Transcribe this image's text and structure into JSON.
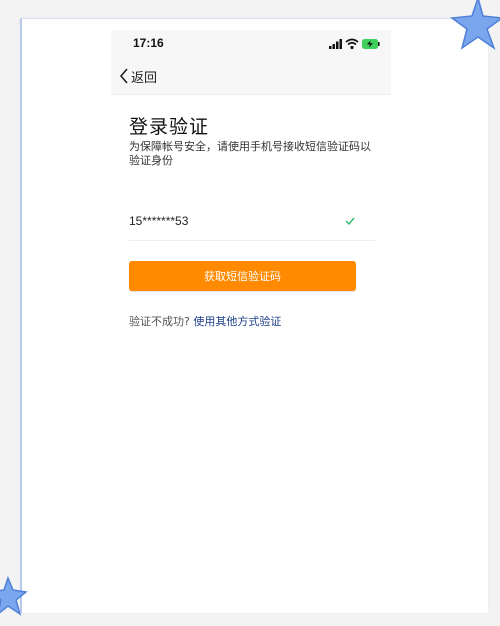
{
  "status_bar": {
    "time": "17:16"
  },
  "nav": {
    "back_label": "返回"
  },
  "verify": {
    "title": "登录验证",
    "description": "为保障帐号安全，请使用手机号接收短信验证码以验证身份",
    "phone": "15*******53"
  },
  "actions": {
    "get_code_button": "获取短信验证码",
    "fail_prompt": "验证不成功?",
    "alt_method_link": "使用其他方式验证"
  },
  "colors": {
    "accent": "#ff8a00",
    "link": "#1e3f8a",
    "check": "#2fb86b",
    "star": "#7aa6ee"
  },
  "icons": {
    "back": "chevron-left-icon",
    "signal": "signal-icon",
    "wifi": "wifi-icon",
    "battery": "battery-charging-icon",
    "verified": "check-icon",
    "decoration": "star-icon"
  }
}
